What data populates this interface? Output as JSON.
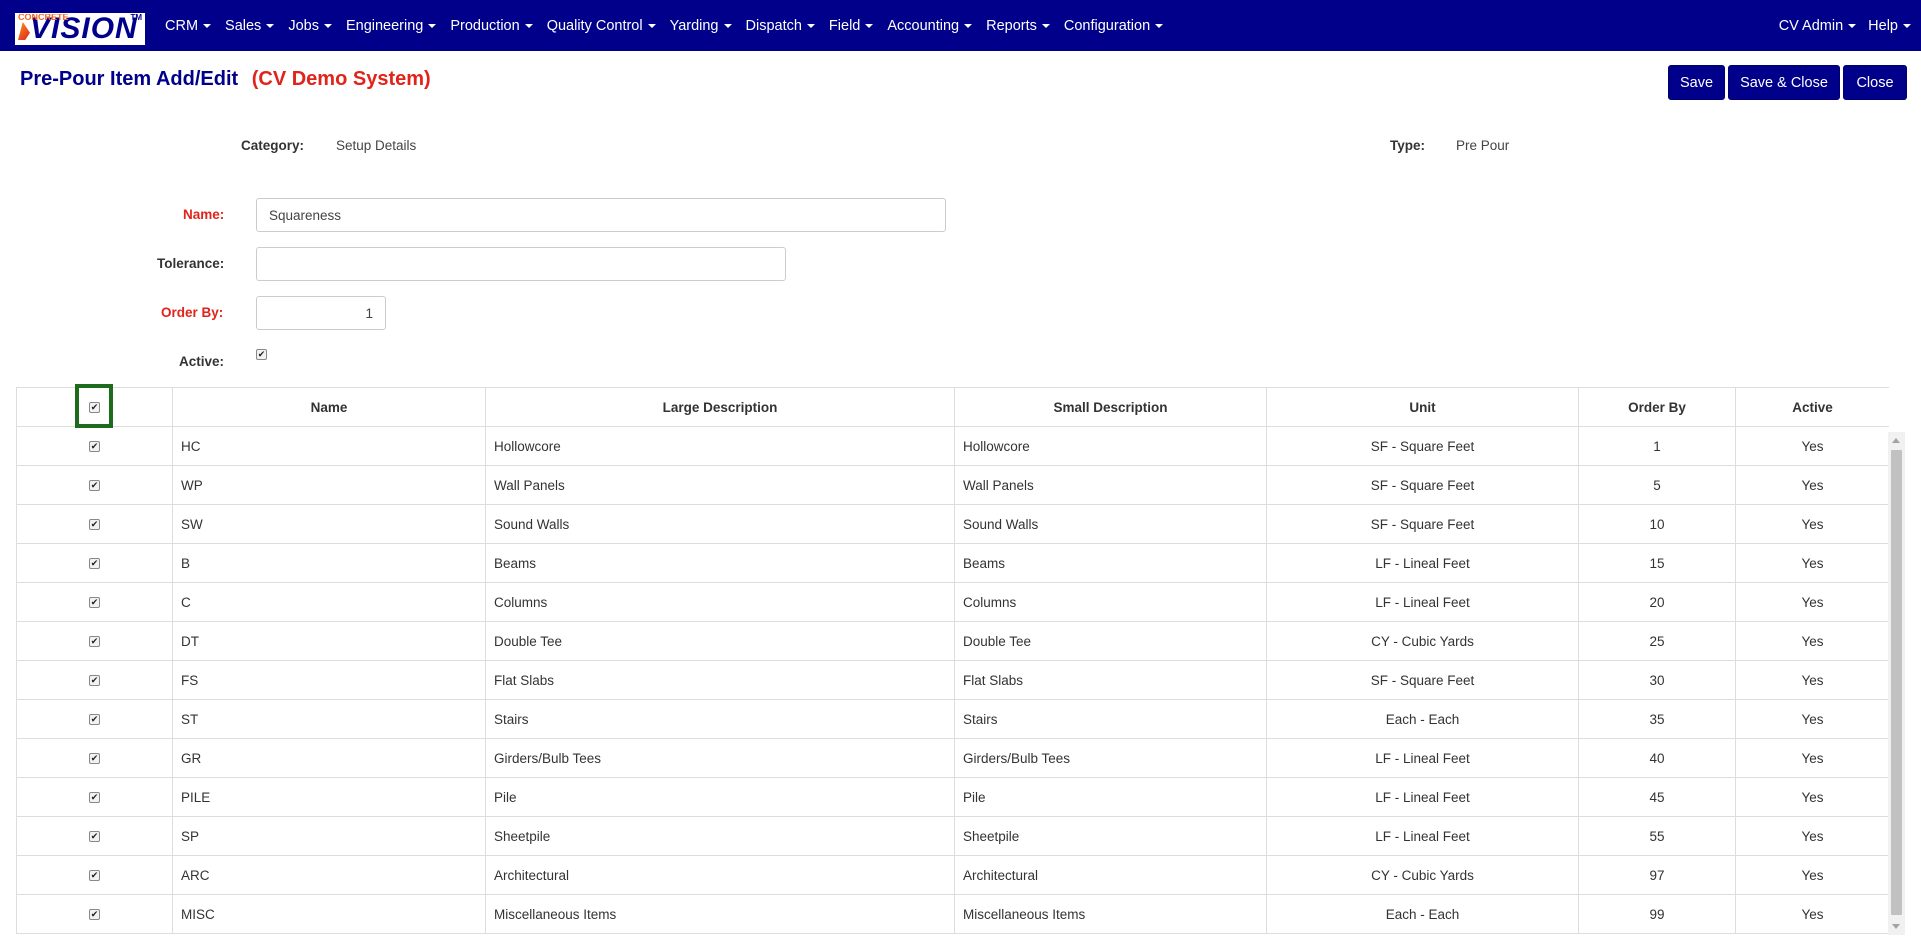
{
  "brand": {
    "top_text": "CONCRETE",
    "main_text": "VISION",
    "tm": "TM"
  },
  "nav": {
    "items": [
      "CRM",
      "Sales",
      "Jobs",
      "Engineering",
      "Production",
      "Quality Control",
      "Yarding",
      "Dispatch",
      "Field",
      "Accounting",
      "Reports",
      "Configuration"
    ],
    "right": [
      "CV Admin",
      "Help"
    ]
  },
  "page": {
    "title": "Pre-Pour Item Add/Edit",
    "system": "(CV Demo System)"
  },
  "buttons": {
    "save": "Save",
    "save_close": "Save & Close",
    "close": "Close"
  },
  "info": {
    "category_label": "Category:",
    "category_value": "Setup Details",
    "type_label": "Type:",
    "type_value": "Pre Pour"
  },
  "form": {
    "name_label": "Name:",
    "name_value": "Squareness",
    "tolerance_label": "Tolerance:",
    "tolerance_value": "",
    "order_label": "Order By:",
    "order_value": "1",
    "active_label": "Active:",
    "active_checked": true
  },
  "table": {
    "headers": [
      "",
      "Name",
      "Large Description",
      "Small Description",
      "Unit",
      "Order By",
      "Active"
    ],
    "rows": [
      [
        "HC",
        "Hollowcore",
        "Hollowcore",
        "SF - Square Feet",
        "1",
        "Yes"
      ],
      [
        "WP",
        "Wall Panels",
        "Wall Panels",
        "SF - Square Feet",
        "5",
        "Yes"
      ],
      [
        "SW",
        "Sound Walls",
        "Sound Walls",
        "SF - Square Feet",
        "10",
        "Yes"
      ],
      [
        "B",
        "Beams",
        "Beams",
        "LF - Lineal Feet",
        "15",
        "Yes"
      ],
      [
        "C",
        "Columns",
        "Columns",
        "LF - Lineal Feet",
        "20",
        "Yes"
      ],
      [
        "DT",
        "Double Tee",
        "Double Tee",
        "CY - Cubic Yards",
        "25",
        "Yes"
      ],
      [
        "FS",
        "Flat Slabs",
        "Flat Slabs",
        "SF - Square Feet",
        "30",
        "Yes"
      ],
      [
        "ST",
        "Stairs",
        "Stairs",
        "Each - Each",
        "35",
        "Yes"
      ],
      [
        "GR",
        "Girders/Bulb Tees",
        "Girders/Bulb Tees",
        "LF - Lineal Feet",
        "40",
        "Yes"
      ],
      [
        "PILE",
        "Pile",
        "Pile",
        "LF - Lineal Feet",
        "45",
        "Yes"
      ],
      [
        "SP",
        "Sheetpile",
        "Sheetpile",
        "LF - Lineal Feet",
        "55",
        "Yes"
      ],
      [
        "ARC",
        "Architectural",
        "Architectural",
        "CY - Cubic Yards",
        "97",
        "Yes"
      ],
      [
        "MISC",
        "Miscellaneous Items",
        "Miscellaneous Items",
        "Each - Each",
        "99",
        "Yes"
      ]
    ]
  },
  "colors": {
    "nav_bg": "#00008b",
    "required": "#e0231b",
    "highlight": "#1e6b1e"
  }
}
